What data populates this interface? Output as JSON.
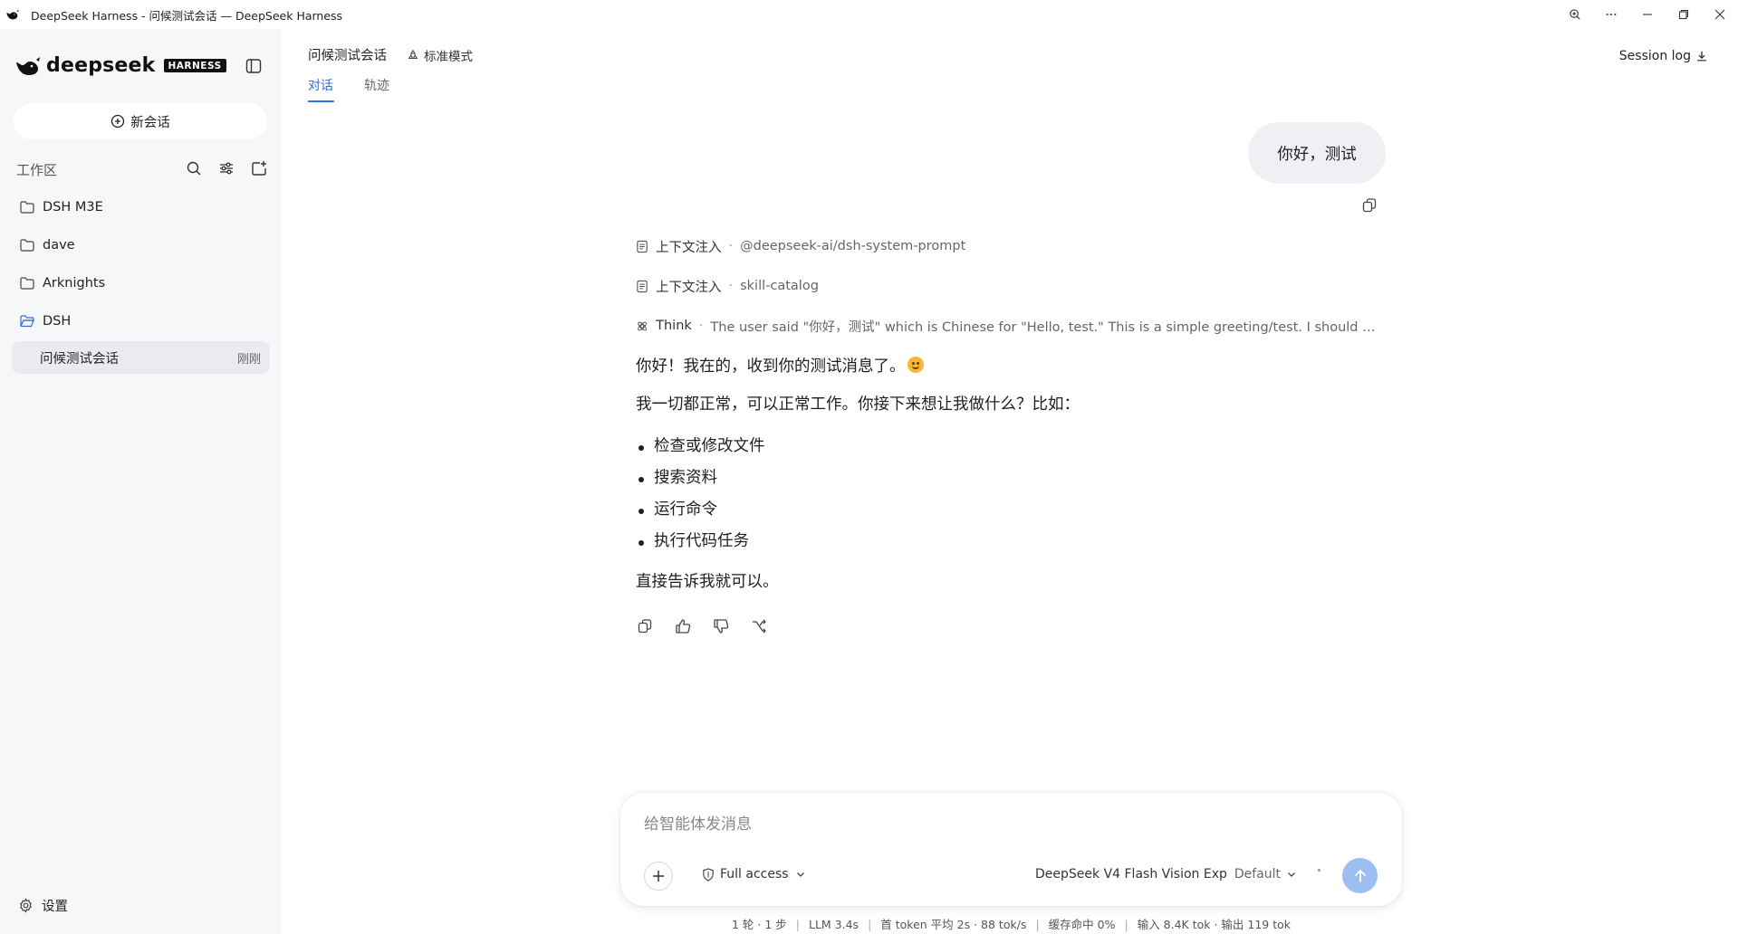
{
  "window": {
    "title": "DeepSeek Harness - 问候测试会话 — DeepSeek Harness"
  },
  "sidebar": {
    "brand": {
      "name": "deepseek",
      "badge": "HARNESS"
    },
    "new_chat_label": "新会话",
    "workspace_label": "工作区",
    "folders": [
      {
        "name": "DSH M3E",
        "open": false
      },
      {
        "name": "dave",
        "open": false
      },
      {
        "name": "Arknights",
        "open": false
      },
      {
        "name": "DSH",
        "open": true
      }
    ],
    "session": {
      "name": "问候测试会话",
      "time": "刚刚"
    },
    "settings_label": "设置"
  },
  "header": {
    "session_title": "问候测试会话",
    "mode": "标准模式",
    "tabs": [
      {
        "label": "对话",
        "active": true
      },
      {
        "label": "轨迹",
        "active": false
      }
    ],
    "session_log": "Session log"
  },
  "conversation": {
    "user_message": "你好，测试",
    "context": [
      {
        "kind": "上下文注入",
        "detail": "@deepseek-ai/dsh-system-prompt"
      },
      {
        "kind": "上下文注入",
        "detail": "skill-catalog"
      },
      {
        "kind": "Think",
        "detail": "The user said \"你好，测试\" which is Chinese for \"Hello, test.\" This is a simple greeting/test. I should respon..."
      }
    ],
    "assistant": {
      "line1": "你好！我在的，收到你的测试消息了。",
      "line2": "我一切都正常，可以正常工作。你接下来想让我做什么？比如：",
      "bullets": [
        "检查或修改文件",
        "搜索资料",
        "运行命令",
        "执行代码任务"
      ],
      "closing": "直接告诉我就可以。"
    }
  },
  "composer": {
    "placeholder": "给智能体发消息",
    "value": "",
    "access_label": "Full access",
    "model_name": "DeepSeek V4 Flash Vision Exp",
    "model_preset": "Default"
  },
  "status": {
    "turns": "1 轮 · 1 步",
    "llm": "LLM 3.4s",
    "first_token": "首 token 平均 2s · 88 tok/s",
    "cache": "缓存命中 0%",
    "tokens": "输入 8.4K tok · 输出 119 tok"
  },
  "colors": {
    "accent": "#2f6de1",
    "send_button": "#9ebdf0",
    "sidebar_bg": "#f6f7f9"
  }
}
